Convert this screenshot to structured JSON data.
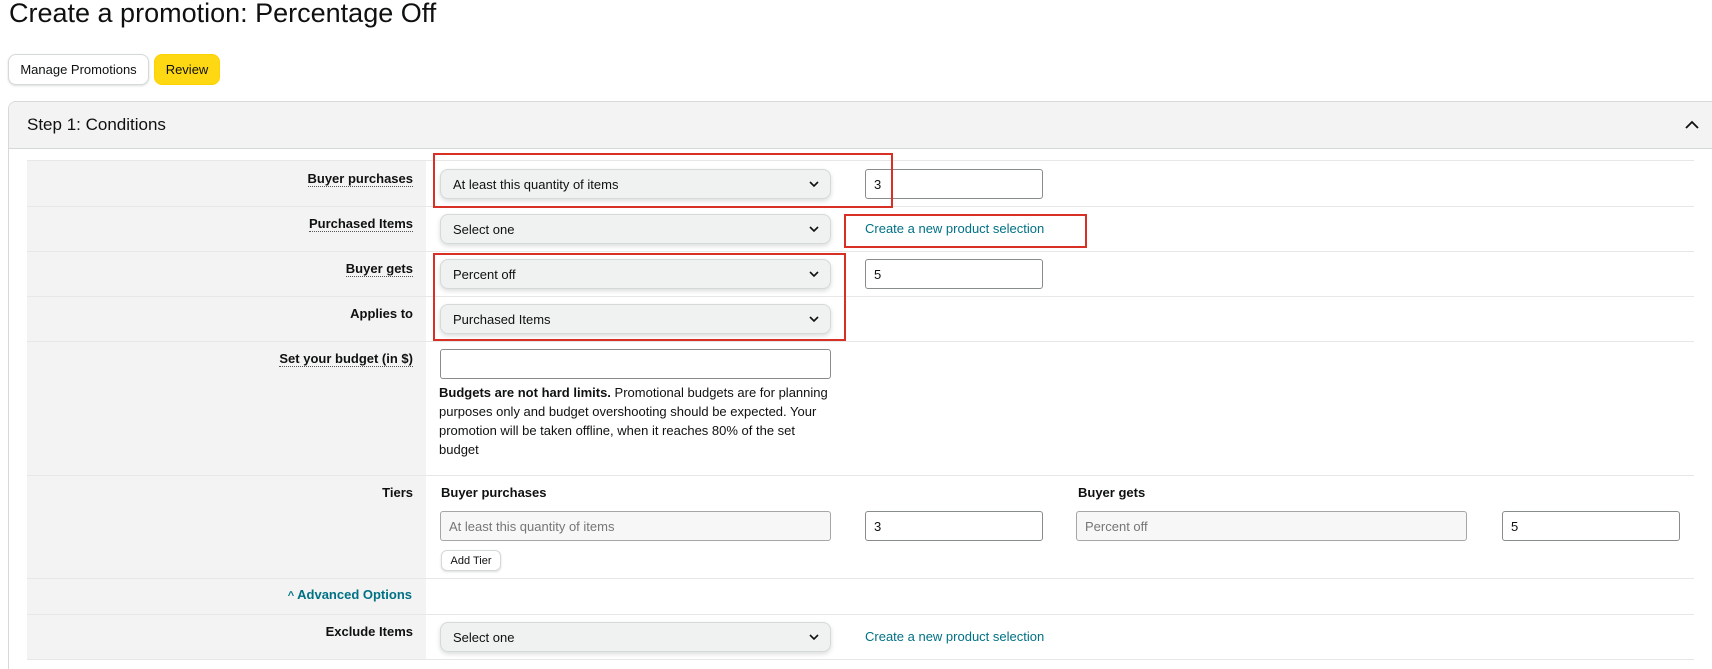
{
  "page": {
    "title": "Create a promotion: Percentage Off"
  },
  "toolbar": {
    "manage_label": "Manage Promotions",
    "review_label": "Review"
  },
  "step": {
    "title": "Step 1: Conditions"
  },
  "form": {
    "buyer_purchases": {
      "label": "Buyer purchases",
      "select_value": "At least this quantity of items",
      "quantity_value": "3"
    },
    "purchased_items": {
      "label": "Purchased Items",
      "select_value": "Select one",
      "link": "Create a new product selection"
    },
    "buyer_gets": {
      "label": "Buyer gets",
      "select_value": "Percent off",
      "amount_value": "5"
    },
    "applies_to": {
      "label": "Applies to",
      "select_value": "Purchased Items"
    },
    "budget": {
      "label": "Set your budget (in $)",
      "value": "",
      "help_bold": "Budgets are not hard limits.",
      "help_text": " Promotional budgets are for planning purposes only and budget overshooting should be expected. Your promotion will be taken offline, when it reaches 80% of the set budget"
    },
    "tiers": {
      "label": "Tiers",
      "col_buyer_purchases": "Buyer purchases",
      "col_buyer_gets": "Buyer gets",
      "purchases_placeholder": "At least this quantity of items",
      "purchases_value": "3",
      "gets_placeholder": "Percent off",
      "gets_value": "5",
      "add_tier_label": "Add Tier"
    },
    "advanced": {
      "label": "Advanced Options",
      "caret": "^"
    },
    "exclude_items": {
      "label": "Exclude Items",
      "select_value": "Select one",
      "link": "Create a new product selection"
    }
  },
  "colors": {
    "accent_yellow": "#ffd814",
    "link_teal": "#007185",
    "highlight_red": "#d93025",
    "row_label_bg": "#f3f3f3"
  },
  "icons": {
    "collapse": "chevron-up-icon",
    "dropdown": "chevron-down-icon"
  }
}
